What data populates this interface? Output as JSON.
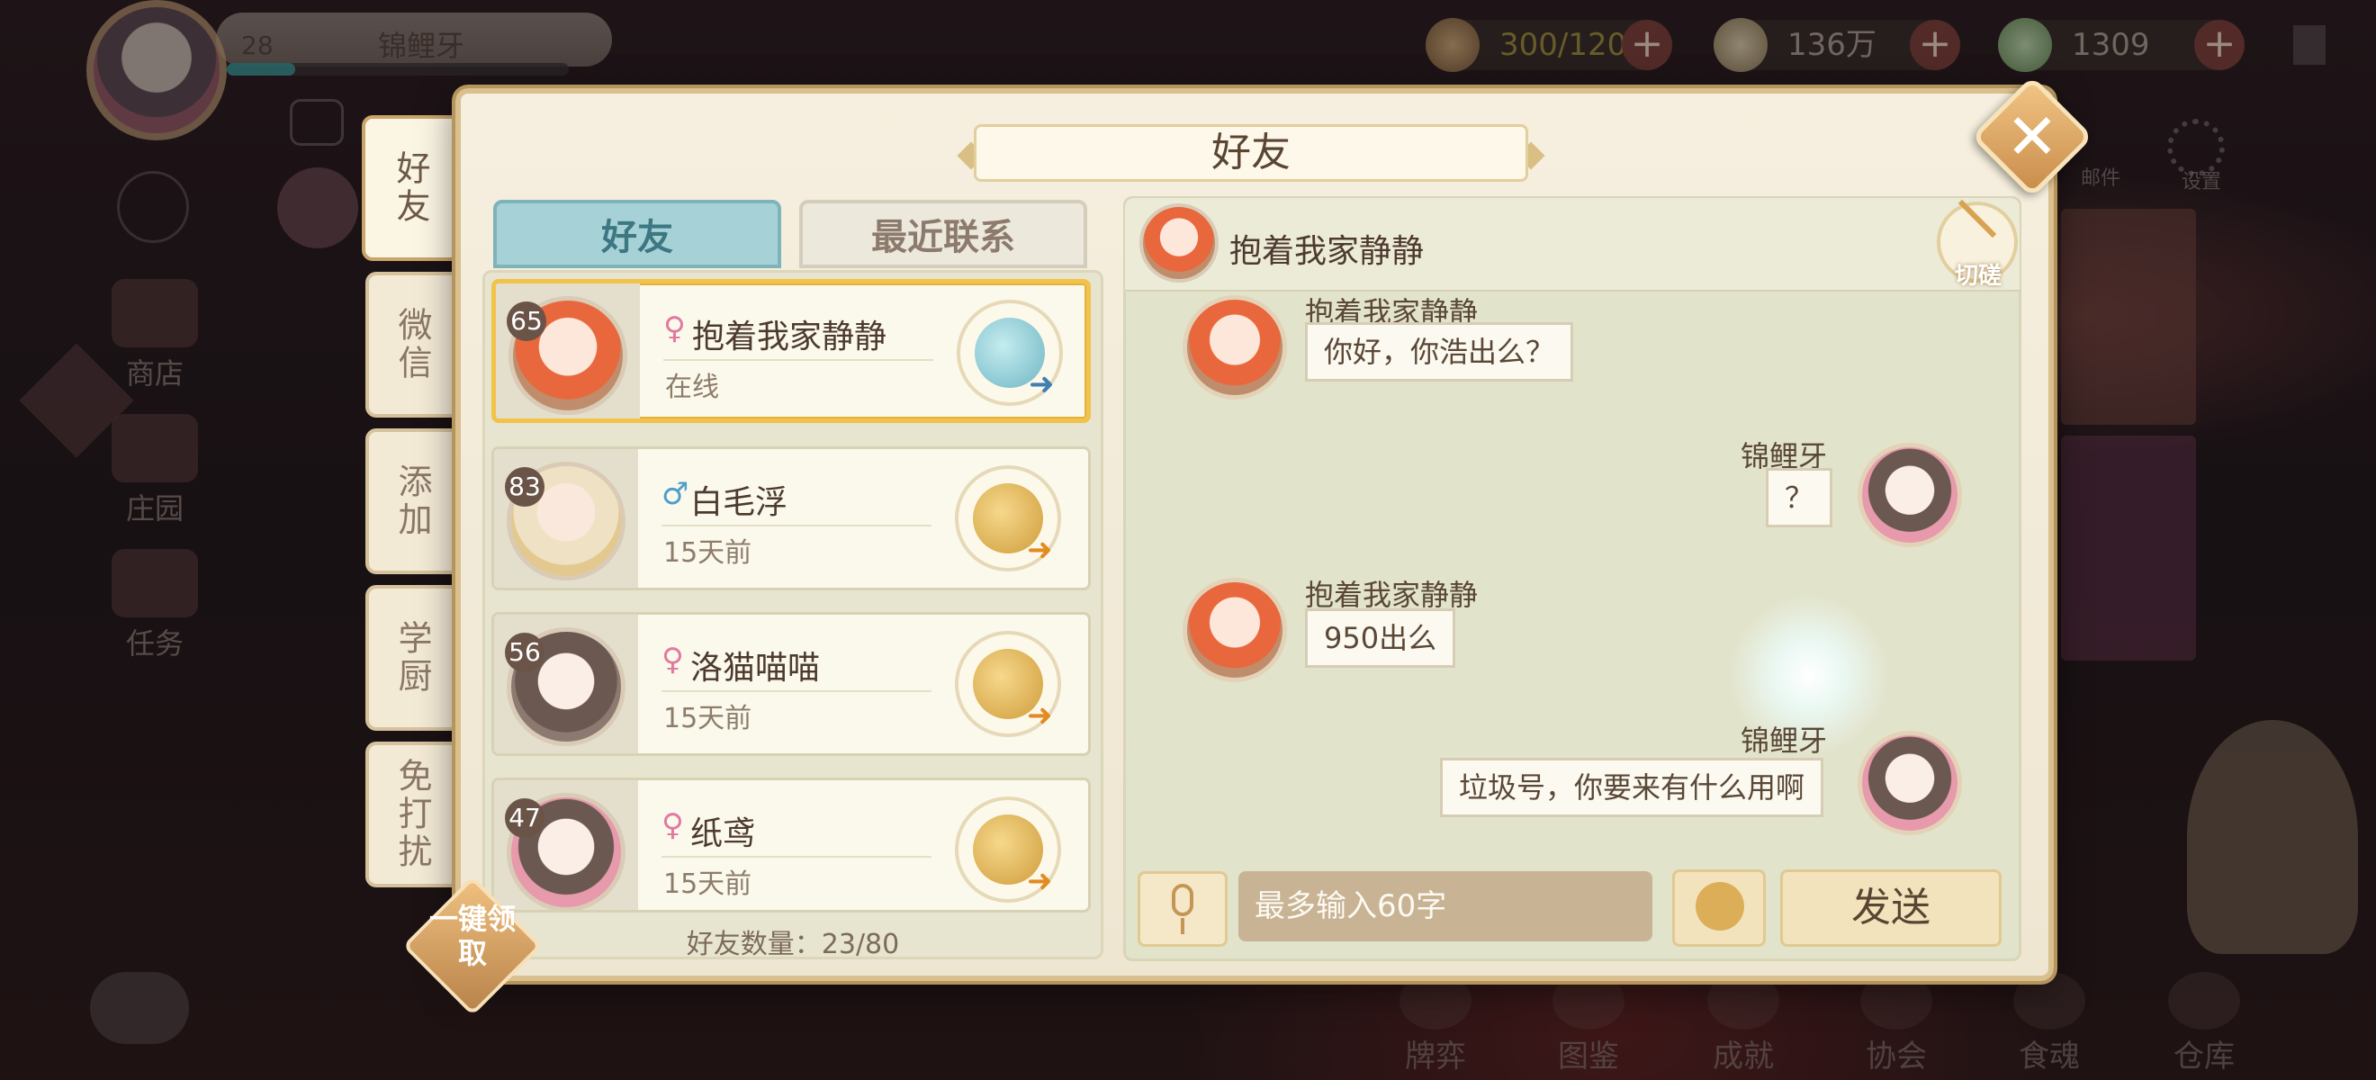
{
  "hud": {
    "player_name": "锦鲤牙",
    "level": "28",
    "exp_fraction": 0.2,
    "stamina": "300/120",
    "coins": "136万",
    "gems": "1309"
  },
  "side_menu": [
    "商店",
    "庄园",
    "任务"
  ],
  "top_right_icons": [
    "邮件",
    "设置"
  ],
  "bottom_bar": [
    "牌弈",
    "图鉴",
    "成就",
    "协会",
    "食魂",
    "仓库"
  ],
  "dialog": {
    "title": "好友",
    "side_tabs": [
      "好友",
      "微信",
      "添加",
      "学厨",
      "免打扰"
    ],
    "list_tabs": [
      "好友",
      "最近联系"
    ],
    "friends": [
      {
        "level": "65",
        "gender": "♀",
        "name": "抱着我家静静",
        "status": "在线"
      },
      {
        "level": "83",
        "gender": "♂",
        "name": "白毛浮",
        "status": "15天前"
      },
      {
        "level": "56",
        "gender": "♀",
        "name": "洛猫喵喵",
        "status": "15天前"
      },
      {
        "level": "47",
        "gender": "♀",
        "name": "纸鸢",
        "status": "15天前"
      }
    ],
    "friend_count": "好友数量：23/80",
    "one_key": "一键领取",
    "chat": {
      "partner": "抱着我家静静",
      "switch_label": "切磋",
      "messages": [
        {
          "from": "抱着我家静静",
          "text": "你好，你浩出么？"
        },
        {
          "from": "锦鲤牙",
          "text": "？"
        },
        {
          "from": "抱着我家静静",
          "text": "950出么"
        },
        {
          "from": "锦鲤牙",
          "text": "垃圾号，你要来有什么用啊"
        }
      ],
      "input_placeholder": "最多输入60字",
      "send_label": "发送"
    }
  },
  "colors": {
    "accent_gold": "#d9c08e",
    "tab_teal": "#a6d1d6",
    "selected_border": "#f1c34a"
  }
}
